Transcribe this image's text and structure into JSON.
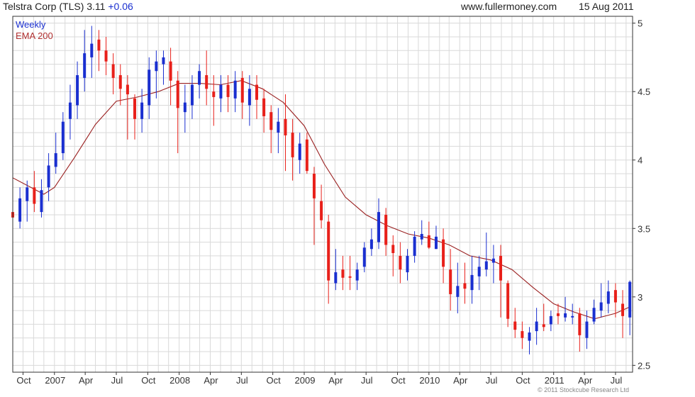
{
  "header": {
    "title": "Telstra Corp (TLS) 3.11",
    "change": "+0.06",
    "site": "www.fullermoney.com",
    "date": "15 Aug 2011"
  },
  "legend": {
    "period": "Weekly",
    "indicator": "EMA 200"
  },
  "copyright": "© 2011 Stockcube Research Ltd",
  "colors": {
    "up": "#1a2fd0",
    "down": "#e8201a",
    "ema": "#9a2020",
    "grid": "#d9d9d9",
    "frame": "#333333"
  },
  "chart_data": {
    "type": "candlestick",
    "ylim": [
      2.45,
      5.05
    ],
    "yticks": [
      2.5,
      3,
      3.5,
      4,
      4.5,
      5
    ],
    "ytick_labels": [
      "2.5",
      "3",
      "3.5",
      "4",
      "4.5",
      "5"
    ],
    "xtick_labels": [
      "Oct",
      "2007",
      "Apr",
      "Jul",
      "Oct",
      "2008",
      "Apr",
      "Jul",
      "Oct",
      "2009",
      "Apr",
      "Jul",
      "Oct",
      "2010",
      "Apr",
      "Jul",
      "Oct",
      "2011",
      "Apr",
      "Jul"
    ],
    "x_range": [
      "2006-09-01",
      "2011-08-20"
    ],
    "grid": true,
    "period": "weekly",
    "series": [
      {
        "name": "EMA 200",
        "kind": "line",
        "x": [
          "2006-09-01",
          "2006-12-01",
          "2007-01-01",
          "2007-03-01",
          "2007-05-01",
          "2007-07-01",
          "2007-09-01",
          "2007-11-01",
          "2008-01-01",
          "2008-03-01",
          "2008-05-01",
          "2008-07-01",
          "2008-09-01",
          "2008-11-01",
          "2009-01-01",
          "2009-03-01",
          "2009-05-01",
          "2009-07-01",
          "2009-09-01",
          "2009-11-01",
          "2010-01-01",
          "2010-03-01",
          "2010-05-01",
          "2010-07-01",
          "2010-09-01",
          "2010-11-01",
          "2011-01-01",
          "2011-03-01",
          "2011-05-01",
          "2011-07-01",
          "2011-08-15"
        ],
        "values": [
          3.87,
          3.75,
          3.8,
          4.02,
          4.26,
          4.43,
          4.46,
          4.5,
          4.56,
          4.56,
          4.55,
          4.58,
          4.52,
          4.42,
          4.25,
          3.97,
          3.73,
          3.6,
          3.52,
          3.46,
          3.43,
          3.38,
          3.3,
          3.27,
          3.2,
          3.07,
          2.95,
          2.89,
          2.84,
          2.88,
          2.93
        ]
      },
      {
        "name": "Weekly",
        "kind": "candles",
        "x": [
          "2006-09-01",
          "2006-09-22",
          "2006-10-13",
          "2006-11-03",
          "2006-11-24",
          "2006-12-15",
          "2007-01-05",
          "2007-01-26",
          "2007-02-16",
          "2007-03-09",
          "2007-03-30",
          "2007-04-20",
          "2007-05-11",
          "2007-06-01",
          "2007-06-22",
          "2007-07-13",
          "2007-08-03",
          "2007-08-24",
          "2007-09-14",
          "2007-10-05",
          "2007-10-26",
          "2007-11-16",
          "2007-12-07",
          "2007-12-28",
          "2008-01-18",
          "2008-02-08",
          "2008-02-29",
          "2008-03-21",
          "2008-04-11",
          "2008-05-02",
          "2008-05-23",
          "2008-06-13",
          "2008-07-04",
          "2008-07-25",
          "2008-08-15",
          "2008-09-05",
          "2008-09-26",
          "2008-10-17",
          "2008-11-07",
          "2008-11-28",
          "2008-12-19",
          "2009-01-09",
          "2009-01-30",
          "2009-02-20",
          "2009-03-13",
          "2009-04-03",
          "2009-04-24",
          "2009-05-15",
          "2009-06-05",
          "2009-06-26",
          "2009-07-17",
          "2009-08-07",
          "2009-08-28",
          "2009-09-18",
          "2009-10-09",
          "2009-10-30",
          "2009-11-20",
          "2009-12-11",
          "2010-01-01",
          "2010-01-22",
          "2010-02-12",
          "2010-03-05",
          "2010-03-26",
          "2010-04-16",
          "2010-05-07",
          "2010-05-28",
          "2010-06-18",
          "2010-07-09",
          "2010-07-30",
          "2010-08-20",
          "2010-09-10",
          "2010-10-01",
          "2010-10-22",
          "2010-11-12",
          "2010-12-03",
          "2010-12-24",
          "2011-01-14",
          "2011-02-04",
          "2011-02-25",
          "2011-03-18",
          "2011-04-08",
          "2011-04-29",
          "2011-05-20",
          "2011-06-10",
          "2011-07-01",
          "2011-07-22",
          "2011-08-12"
        ],
        "open": [
          3.62,
          3.55,
          3.7,
          3.8,
          3.62,
          3.8,
          3.95,
          4.05,
          4.3,
          4.4,
          4.6,
          4.75,
          4.88,
          4.8,
          4.7,
          4.62,
          4.55,
          4.45,
          4.3,
          4.4,
          4.65,
          4.7,
          4.72,
          4.58,
          4.35,
          4.4,
          4.55,
          4.62,
          4.5,
          4.45,
          4.55,
          4.45,
          4.6,
          4.4,
          4.55,
          4.45,
          4.35,
          4.2,
          4.3,
          4.2,
          4.0,
          4.15,
          3.9,
          3.7,
          3.55,
          3.1,
          3.2,
          3.15,
          3.12,
          3.22,
          3.35,
          3.4,
          3.6,
          3.38,
          3.3,
          3.18,
          3.3,
          3.42,
          3.45,
          3.35,
          3.42,
          3.2,
          3.0,
          3.1,
          3.05,
          3.15,
          3.2,
          3.25,
          3.3,
          3.1,
          2.82,
          2.75,
          2.68,
          2.75,
          2.8,
          2.8,
          2.88,
          2.85,
          2.85,
          2.88,
          2.7,
          2.82,
          2.9,
          2.95,
          3.05,
          2.95,
          2.85
        ],
        "high": [
          3.68,
          3.8,
          3.85,
          3.92,
          3.86,
          4.05,
          4.2,
          4.35,
          4.55,
          4.72,
          4.95,
          4.98,
          4.95,
          4.9,
          4.78,
          4.7,
          4.62,
          4.48,
          4.52,
          4.75,
          4.8,
          4.8,
          4.82,
          4.65,
          4.55,
          4.62,
          4.7,
          4.8,
          4.62,
          4.62,
          4.62,
          4.65,
          4.65,
          4.62,
          4.62,
          4.52,
          4.4,
          4.38,
          4.48,
          4.3,
          4.2,
          4.2,
          3.95,
          3.82,
          3.6,
          3.35,
          3.3,
          3.3,
          3.25,
          3.4,
          3.5,
          3.72,
          3.65,
          3.45,
          3.4,
          3.35,
          3.48,
          3.56,
          3.55,
          3.52,
          3.5,
          3.35,
          3.25,
          3.25,
          3.3,
          3.3,
          3.47,
          3.38,
          3.38,
          3.12,
          2.92,
          2.82,
          2.78,
          2.92,
          2.95,
          2.9,
          2.95,
          3.0,
          2.95,
          2.92,
          2.9,
          2.98,
          3.1,
          3.12,
          3.1,
          3.05,
          3.12
        ],
        "low": [
          3.52,
          3.5,
          3.55,
          3.62,
          3.58,
          3.7,
          3.9,
          4.0,
          4.15,
          4.3,
          4.5,
          4.6,
          4.65,
          4.62,
          4.48,
          4.4,
          4.15,
          4.15,
          4.2,
          4.3,
          4.45,
          4.55,
          4.4,
          4.05,
          4.2,
          4.3,
          4.45,
          4.4,
          4.25,
          4.35,
          4.35,
          4.35,
          4.3,
          4.25,
          4.3,
          4.2,
          4.05,
          4.05,
          3.92,
          3.85,
          3.9,
          3.9,
          3.38,
          3.5,
          2.95,
          3.05,
          3.05,
          3.05,
          3.05,
          3.18,
          3.3,
          3.35,
          3.3,
          3.15,
          3.1,
          3.12,
          3.25,
          3.38,
          3.35,
          3.35,
          3.1,
          2.9,
          2.88,
          2.95,
          2.95,
          3.05,
          3.15,
          3.1,
          2.85,
          2.78,
          2.7,
          2.62,
          2.58,
          2.65,
          2.75,
          2.75,
          2.8,
          2.82,
          2.8,
          2.6,
          2.62,
          2.8,
          2.85,
          2.88,
          2.85,
          2.7,
          2.72
        ],
        "close": [
          3.58,
          3.72,
          3.8,
          3.68,
          3.78,
          3.96,
          4.05,
          4.28,
          4.42,
          4.62,
          4.78,
          4.85,
          4.8,
          4.72,
          4.6,
          4.52,
          4.48,
          4.3,
          4.42,
          4.66,
          4.72,
          4.75,
          4.58,
          4.38,
          4.42,
          4.55,
          4.65,
          4.52,
          4.46,
          4.55,
          4.46,
          4.58,
          4.42,
          4.52,
          4.44,
          4.32,
          4.22,
          4.28,
          4.18,
          4.02,
          4.12,
          3.92,
          3.72,
          3.56,
          3.12,
          3.18,
          3.14,
          3.14,
          3.2,
          3.36,
          3.42,
          3.62,
          3.38,
          3.32,
          3.2,
          3.3,
          3.44,
          3.46,
          3.36,
          3.44,
          3.22,
          3.02,
          3.08,
          3.06,
          3.16,
          3.22,
          3.26,
          3.28,
          3.12,
          2.84,
          2.76,
          2.7,
          2.74,
          2.82,
          2.78,
          2.86,
          2.86,
          2.88,
          2.86,
          2.72,
          2.82,
          2.92,
          2.96,
          3.04,
          2.96,
          2.86,
          3.11
        ]
      }
    ]
  }
}
